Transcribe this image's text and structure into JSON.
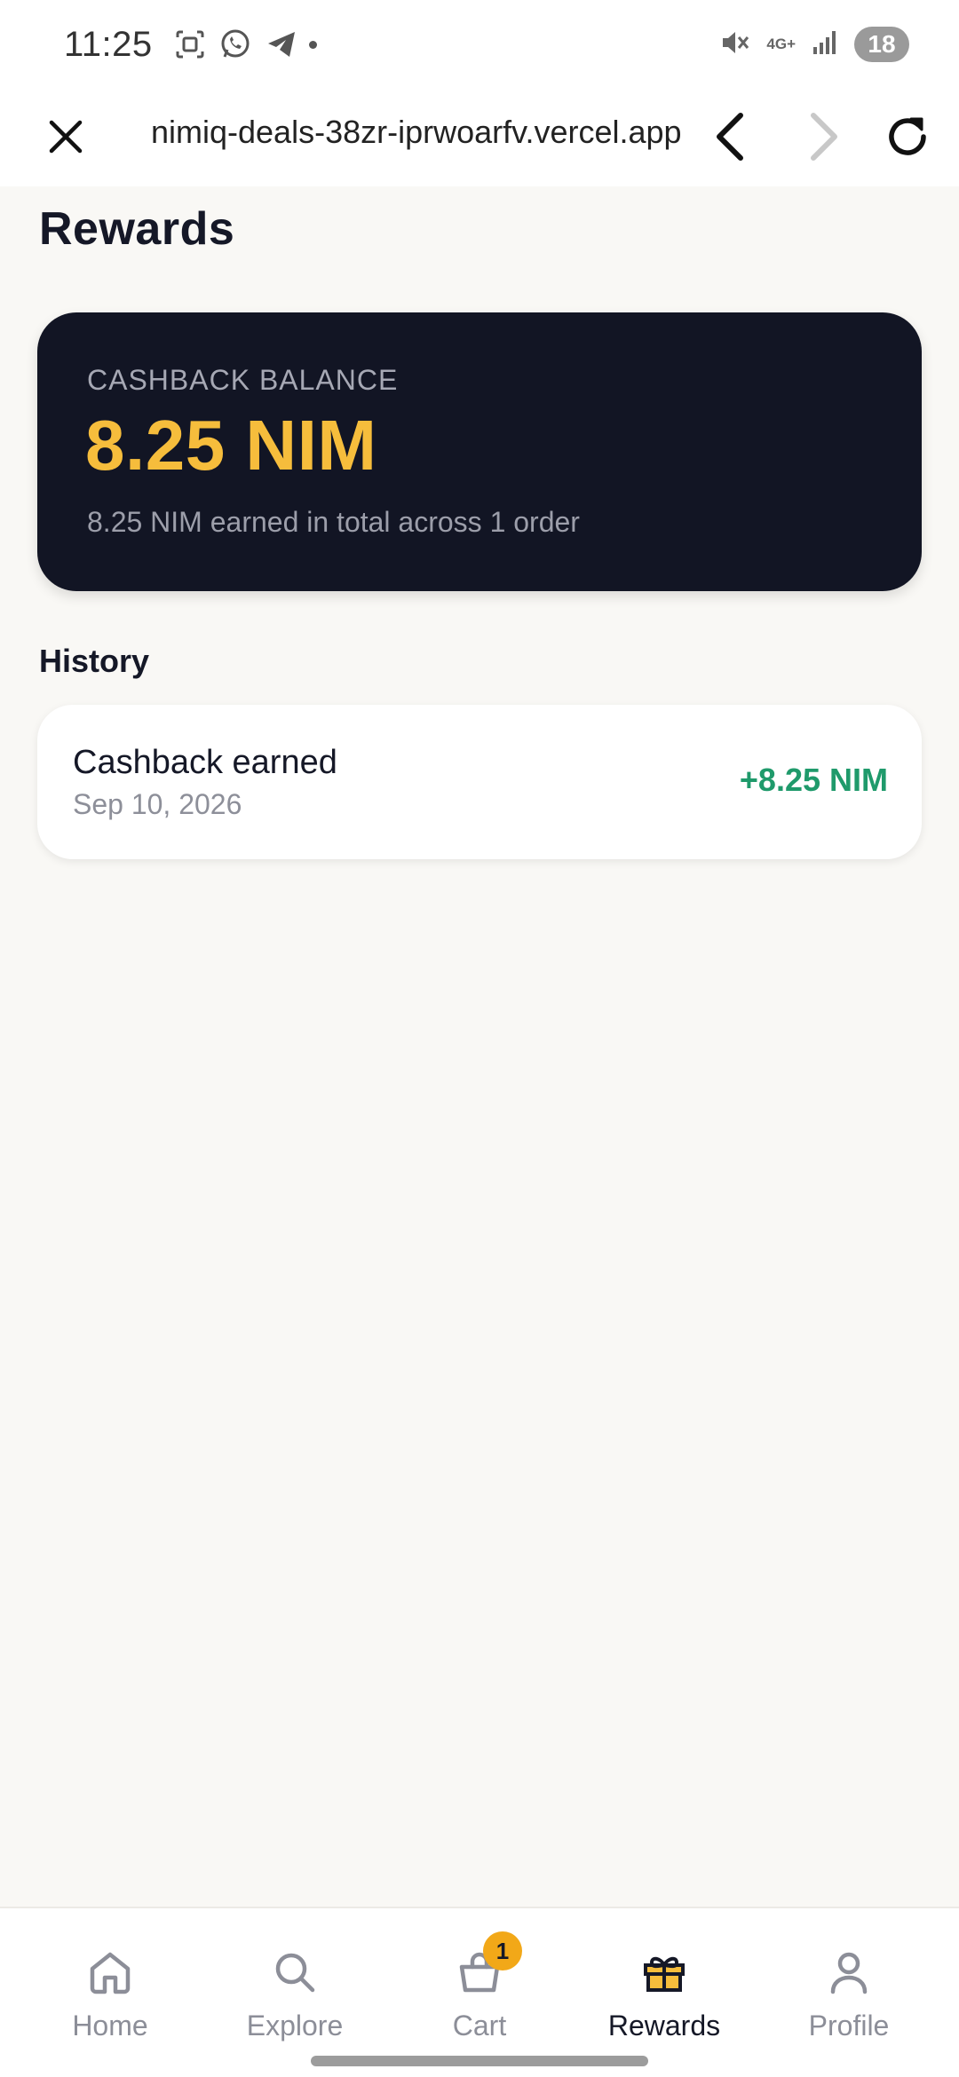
{
  "status_bar": {
    "time": "11:25",
    "network": "4G+",
    "battery": "18",
    "icons": [
      "screenshot-icon",
      "whatsapp-icon",
      "telegram-icon",
      "mute-icon",
      "signal-icon",
      "battery-icon"
    ]
  },
  "browser": {
    "url": "nimiq-deals-38zr-iprwoarfv.vercel.app",
    "icons": [
      "close-icon",
      "back-icon",
      "forward-icon",
      "reload-icon"
    ]
  },
  "page": {
    "title": "Rewards"
  },
  "balance": {
    "label": "CASHBACK BALANCE",
    "amount": "8.25 NIM",
    "summary": "8.25 NIM earned in total across 1 order"
  },
  "history": {
    "title": "History",
    "items": [
      {
        "title": "Cashback earned",
        "date": "Sep 10, 2026",
        "amount": "+8.25 NIM"
      }
    ]
  },
  "nav": {
    "items": [
      {
        "label": "Home",
        "icon": "home-icon"
      },
      {
        "label": "Explore",
        "icon": "search-icon"
      },
      {
        "label": "Cart",
        "icon": "cart-icon",
        "badge": "1"
      },
      {
        "label": "Rewards",
        "icon": "gift-icon",
        "active": true
      },
      {
        "label": "Profile",
        "icon": "profile-icon"
      }
    ]
  },
  "colors": {
    "background": "#f9f8f5",
    "card_dark": "#121524",
    "accent_gold": "#f6bd3c",
    "positive_green": "#1f9a6b",
    "badge": "#f2a818"
  }
}
